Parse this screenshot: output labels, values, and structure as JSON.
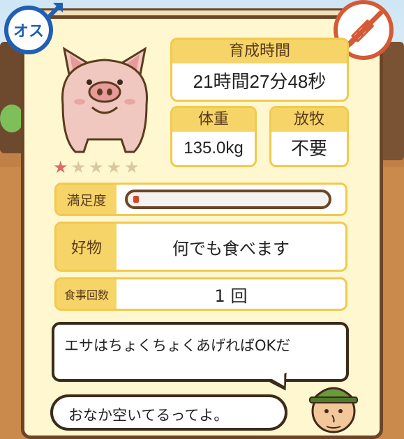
{
  "gender": {
    "label": "オス",
    "color": "#1f5fb5"
  },
  "medicine_badge": {
    "icon": "no-injection-icon",
    "color": "#d45a37"
  },
  "pig": {
    "icon": "pig-portrait"
  },
  "rating": {
    "filled": 1,
    "total": 5,
    "filled_color": "#d96b6b",
    "empty_color": "#d8c9a0"
  },
  "raising_time": {
    "label": "育成時間",
    "value": "21時間27分48秒"
  },
  "weight": {
    "label": "体重",
    "value": "135.0kg"
  },
  "grazing": {
    "label": "放牧",
    "value": "不要"
  },
  "satisfaction": {
    "label": "満足度",
    "level": 0.03,
    "fill_color": "#d6462b"
  },
  "favorite_food": {
    "label": "好物",
    "value": "何でも食べます"
  },
  "meal_count": {
    "label": "食事回数",
    "value": "1 回"
  },
  "speech": {
    "line1": "エサはちょくちょくあげればOKだ",
    "line2": "おなか空いてるってよ。"
  },
  "farmer": {
    "icon": "farmer-avatar"
  }
}
